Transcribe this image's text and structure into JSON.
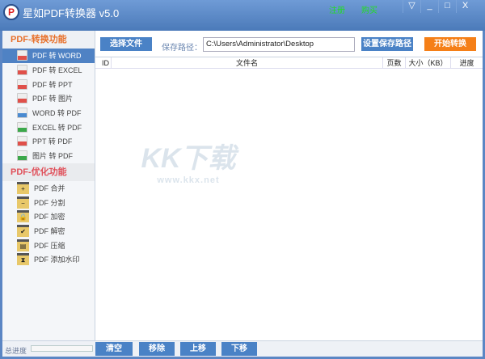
{
  "titlebar": {
    "logo": "P",
    "title": "星如PDF转换器 v5.0",
    "register": "注册",
    "buy": "购买",
    "menu_icon": "▽",
    "min_icon": "_",
    "max_icon": "□",
    "close_icon": "X"
  },
  "sidebar": {
    "section1": "PDF-转换功能",
    "convert_items": [
      {
        "label": "PDF 转 WORD",
        "icon": "pdf",
        "color": "#e0504a"
      },
      {
        "label": "PDF 转 EXCEL",
        "icon": "pdf",
        "color": "#e0504a"
      },
      {
        "label": "PDF 转 PPT",
        "icon": "pdf",
        "color": "#e0504a"
      },
      {
        "label": "PDF 转 图片",
        "icon": "pdf",
        "color": "#e0504a"
      },
      {
        "label": "WORD 转 PDF",
        "icon": "word",
        "color": "#4a8ad0"
      },
      {
        "label": "EXCEL 转 PDF",
        "icon": "excel",
        "color": "#3ca84a"
      },
      {
        "label": "PPT 转 PDF",
        "icon": "ppt",
        "color": "#e0504a"
      },
      {
        "label": "图片 转 PDF",
        "icon": "image",
        "color": "#3ca84a"
      }
    ],
    "section2": "PDF-优化功能",
    "optimize_items": [
      {
        "label": "PDF 合并",
        "glyph": "+"
      },
      {
        "label": "PDF 分割",
        "glyph": "−"
      },
      {
        "label": "PDF 加密",
        "glyph": "🔒"
      },
      {
        "label": "PDF 解密",
        "glyph": "✔"
      },
      {
        "label": "PDF 压缩",
        "glyph": "▤"
      },
      {
        "label": "PDF 添加水印",
        "glyph": "⧗"
      }
    ]
  },
  "toolbar": {
    "select_file": "选择文件",
    "save_path_label": "保存路径：",
    "save_path": "C:\\Users\\Administrator\\Desktop",
    "set_path": "设置保存路径",
    "start": "开始转换"
  },
  "table": {
    "columns": [
      "ID",
      "文件名",
      "页数",
      "大小（KB）",
      "进度"
    ]
  },
  "bottom": {
    "progress_label": "总进度",
    "progress": 0,
    "clear": "清空",
    "remove": "移除",
    "up": "上移",
    "down": "下移"
  },
  "watermark": {
    "big": "KK下载",
    "small": "www.kkx.net"
  },
  "colors": {
    "accent": "#4a82c6",
    "start": "#f57f17"
  }
}
